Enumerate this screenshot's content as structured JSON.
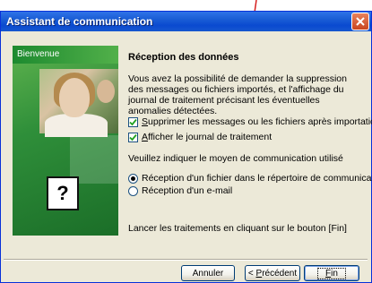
{
  "window": {
    "title": "Assistant de communication"
  },
  "sidebar": {
    "welcome_label": "Bienvenue",
    "doc_glyph": "?"
  },
  "main": {
    "heading": "Réception des données",
    "description": "Vous avez la possibilité de demander la suppression des messages ou fichiers importés, et l'affichage du journal de traitement précisant les éventuelles anomalies détectées.",
    "options": [
      {
        "accel": "S",
        "rest": "upprimer les messages ou les fichiers après importation",
        "checked": true
      },
      {
        "accel": "A",
        "rest": "fficher le journal de traitement",
        "checked": true
      }
    ],
    "method_label": "Veuillez indiquer le moyen de communication utilisé",
    "methods": [
      {
        "label": "Réception d'un fichier dans le répertoire de communication",
        "selected": true
      },
      {
        "label": "Réception d'un e-mail",
        "selected": false
      }
    ],
    "instruction": "Lancer les traitements en cliquant sur le bouton [Fin]"
  },
  "buttons": {
    "cancel": "Annuler",
    "previous_prefix": "< ",
    "previous_accel": "P",
    "previous_rest": "récédent",
    "finish_accel": "F",
    "finish_rest": "in"
  },
  "colors": {
    "titlebar": "#0a4ad0",
    "annotation_arrow": "#d62020"
  }
}
